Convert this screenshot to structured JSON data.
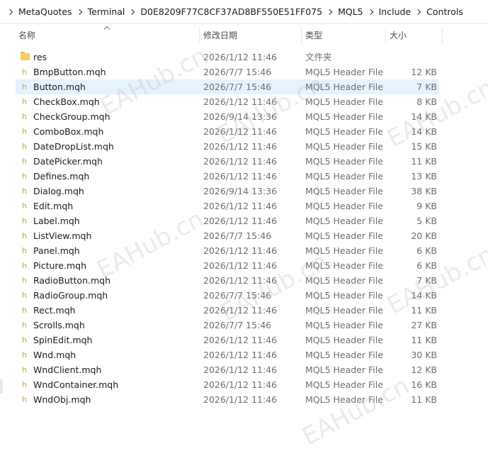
{
  "breadcrumb": [
    "MetaQuotes",
    "Terminal",
    "D0E8209F77C8CF37AD8BF550E51FF075",
    "MQL5",
    "Include",
    "Controls"
  ],
  "columns": {
    "name": "名称",
    "date": "修改日期",
    "type": "类型",
    "size": "大小"
  },
  "files": [
    {
      "name": "res",
      "date": "2026/1/12 11:46",
      "type": "文件夹",
      "size": "",
      "icon": "folder-icon"
    },
    {
      "name": "BmpButton.mqh",
      "date": "2026/7/7 15:46",
      "type": "MQL5 Header File",
      "size": "12 KB",
      "icon": "h-icon"
    },
    {
      "name": "Button.mqh",
      "date": "2026/7/7 15:46",
      "type": "MQL5 Header File",
      "size": "7 KB",
      "icon": "h-icon",
      "selected": true
    },
    {
      "name": "CheckBox.mqh",
      "date": "2026/1/12 11:46",
      "type": "MQL5 Header File",
      "size": "8 KB",
      "icon": "h-icon"
    },
    {
      "name": "CheckGroup.mqh",
      "date": "2026/9/14 13:36",
      "type": "MQL5 Header File",
      "size": "14 KB",
      "icon": "h-icon"
    },
    {
      "name": "ComboBox.mqh",
      "date": "2026/1/12 11:46",
      "type": "MQL5 Header File",
      "size": "14 KB",
      "icon": "h-icon"
    },
    {
      "name": "DateDropList.mqh",
      "date": "2026/1/12 11:46",
      "type": "MQL5 Header File",
      "size": "15 KB",
      "icon": "h-icon"
    },
    {
      "name": "DatePicker.mqh",
      "date": "2026/1/12 11:46",
      "type": "MQL5 Header File",
      "size": "11 KB",
      "icon": "h-icon"
    },
    {
      "name": "Defines.mqh",
      "date": "2026/1/12 11:46",
      "type": "MQL5 Header File",
      "size": "13 KB",
      "icon": "h-icon"
    },
    {
      "name": "Dialog.mqh",
      "date": "2026/9/14 13:36",
      "type": "MQL5 Header File",
      "size": "38 KB",
      "icon": "h-icon"
    },
    {
      "name": "Edit.mqh",
      "date": "2026/1/12 11:46",
      "type": "MQL5 Header File",
      "size": "9 KB",
      "icon": "h-icon"
    },
    {
      "name": "Label.mqh",
      "date": "2026/1/12 11:46",
      "type": "MQL5 Header File",
      "size": "5 KB",
      "icon": "h-icon"
    },
    {
      "name": "ListView.mqh",
      "date": "2026/7/7 15:46",
      "type": "MQL5 Header File",
      "size": "20 KB",
      "icon": "h-icon"
    },
    {
      "name": "Panel.mqh",
      "date": "2026/1/12 11:46",
      "type": "MQL5 Header File",
      "size": "6 KB",
      "icon": "h-icon"
    },
    {
      "name": "Picture.mqh",
      "date": "2026/1/12 11:46",
      "type": "MQL5 Header File",
      "size": "6 KB",
      "icon": "h-icon"
    },
    {
      "name": "RadioButton.mqh",
      "date": "2026/1/12 11:46",
      "type": "MQL5 Header File",
      "size": "7 KB",
      "icon": "h-icon"
    },
    {
      "name": "RadioGroup.mqh",
      "date": "2026/7/7 15:46",
      "type": "MQL5 Header File",
      "size": "14 KB",
      "icon": "h-icon"
    },
    {
      "name": "Rect.mqh",
      "date": "2026/1/12 11:46",
      "type": "MQL5 Header File",
      "size": "11 KB",
      "icon": "h-icon"
    },
    {
      "name": "Scrolls.mqh",
      "date": "2026/7/7 15:46",
      "type": "MQL5 Header File",
      "size": "27 KB",
      "icon": "h-icon"
    },
    {
      "name": "SpinEdit.mqh",
      "date": "2026/1/12 11:46",
      "type": "MQL5 Header File",
      "size": "11 KB",
      "icon": "h-icon"
    },
    {
      "name": "Wnd.mqh",
      "date": "2026/1/12 11:46",
      "type": "MQL5 Header File",
      "size": "30 KB",
      "icon": "h-icon"
    },
    {
      "name": "WndClient.mqh",
      "date": "2026/1/12 11:46",
      "type": "MQL5 Header File",
      "size": "12 KB",
      "icon": "h-icon"
    },
    {
      "name": "WndContainer.mqh",
      "date": "2026/1/12 11:46",
      "type": "MQL5 Header File",
      "size": "16 KB",
      "icon": "h-icon"
    },
    {
      "name": "WndObj.mqh",
      "date": "2026/1/12 11:46",
      "type": "MQL5 Header File",
      "size": "11 KB",
      "icon": "h-icon"
    }
  ],
  "watermark": "EAHub.cn",
  "colors": {
    "selection": "#e5f3ff",
    "folder": "#f6cf5d",
    "header_icon": "#c8a030"
  }
}
